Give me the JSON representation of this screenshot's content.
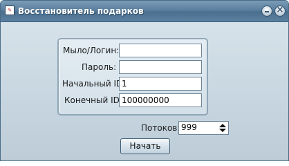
{
  "window": {
    "title": "Восстановитель подарков",
    "icon": "app-icon"
  },
  "form": {
    "login_label": "Мыло/Логин:",
    "login_value": "",
    "password_label": "Пароль:",
    "password_value": "",
    "start_id_label": "Начальный ID:",
    "start_id_value": "1",
    "end_id_label": "Конечный ID:",
    "end_id_value": "100000000"
  },
  "threads": {
    "label": "Потоков:",
    "value": "999"
  },
  "actions": {
    "start_label": "Начать"
  }
}
